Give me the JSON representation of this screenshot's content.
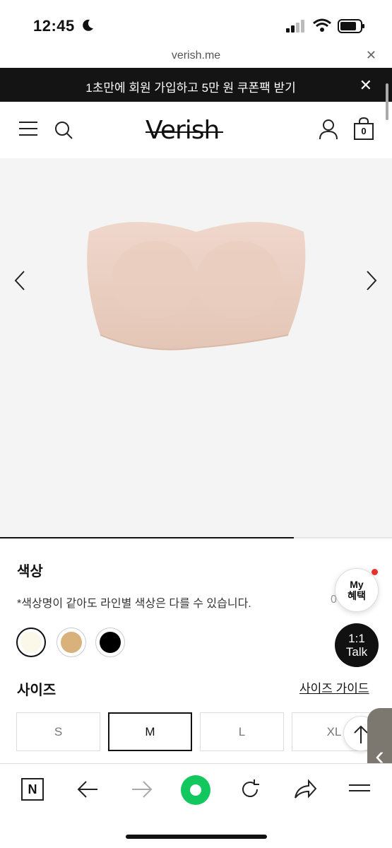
{
  "status_bar": {
    "time": "12:45",
    "icons": [
      "moon-icon",
      "signal-icon",
      "wifi-icon",
      "battery-icon"
    ]
  },
  "browser": {
    "url": "verish.me"
  },
  "promo": {
    "text": "1초만에 회원 가입하고 5만 원 쿠폰팩 받기"
  },
  "header": {
    "logo": "Verish",
    "cart_count": "0"
  },
  "gallery": {
    "progress_fraction": 0.75
  },
  "color": {
    "label": "색상",
    "note": "*색상명이 같아도 라인별 색상은 다를 수 있습니다.",
    "note_count": "0",
    "swatches": [
      {
        "name": "ivory",
        "hex": "#fbf8ea",
        "selected": true
      },
      {
        "name": "beige",
        "hex": "#d8b27a",
        "selected": false
      },
      {
        "name": "black",
        "hex": "#000000",
        "selected": false
      }
    ]
  },
  "size": {
    "label": "사이즈",
    "guide": "사이즈 가이드",
    "options": [
      "S",
      "M",
      "L",
      "XL"
    ],
    "selected": "M"
  },
  "floating": {
    "my_line1": "My",
    "my_line2": "혜택",
    "talk_line1": "1:1",
    "talk_line2": "Talk"
  },
  "colors": {
    "brand_green": "#12c85e",
    "promo_bg": "#141414"
  }
}
